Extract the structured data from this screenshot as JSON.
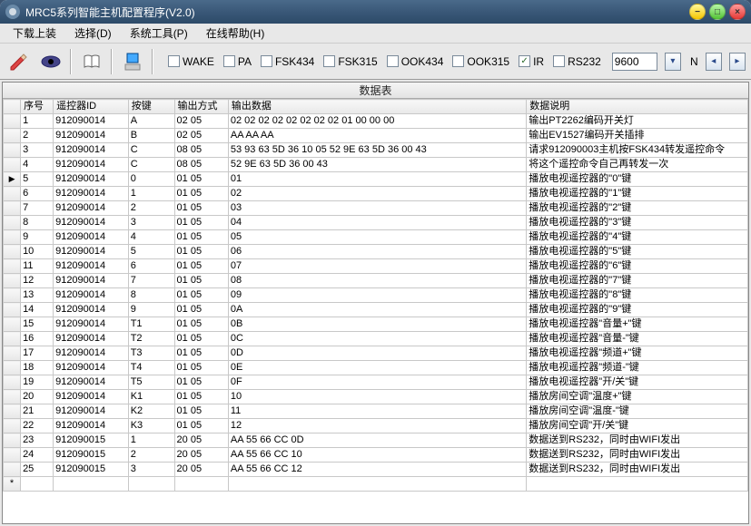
{
  "window": {
    "title": "MRC5系列智能主机配置程序(V2.0)"
  },
  "menu": {
    "download": "下载上装",
    "select": "选择(D)",
    "tools": "系统工具(P)",
    "help": "在线帮助(H)"
  },
  "checks": [
    {
      "label": "WAKE",
      "checked": false
    },
    {
      "label": "PA",
      "checked": false
    },
    {
      "label": "FSK434",
      "checked": false
    },
    {
      "label": "FSK315",
      "checked": false
    },
    {
      "label": "OOK434",
      "checked": false
    },
    {
      "label": "OOK315",
      "checked": false
    },
    {
      "label": "IR",
      "checked": true
    },
    {
      "label": "RS232",
      "checked": false
    }
  ],
  "baud": "9600",
  "navlabel": "N",
  "table": {
    "title": "数据表",
    "cols": {
      "seq": "序号",
      "id": "遥控器ID",
      "key": "按键",
      "mode": "输出方式",
      "out": "输出数据",
      "desc": "数据说明"
    },
    "rows": [
      {
        "seq": "1",
        "id": "912090014",
        "key": "A",
        "mode": "02 05",
        "out": "02 02 02 02 02 02 02 02 01 00 00 00",
        "desc": "输出PT2262编码开关灯"
      },
      {
        "seq": "2",
        "id": "912090014",
        "key": "B",
        "mode": "02 05",
        "out": "AA AA AA",
        "desc": "输出EV1527编码开关插排"
      },
      {
        "seq": "3",
        "id": "912090014",
        "key": "C",
        "mode": "08 05",
        "out": "53 93 63 5D 36 10 05 52 9E 63 5D 36 00 43",
        "desc": "请求912090003主机按FSK434转发遥控命令"
      },
      {
        "seq": "4",
        "id": "912090014",
        "key": "C",
        "mode": "08 05",
        "out": "52 9E 63 5D 36 00 43",
        "desc": "将这个遥控命令自己再转发一次"
      },
      {
        "seq": "5",
        "id": "912090014",
        "key": "0",
        "mode": "01 05",
        "out": "01",
        "desc": "播放电视遥控器的\"0\"键",
        "sel": true
      },
      {
        "seq": "6",
        "id": "912090014",
        "key": "1",
        "mode": "01 05",
        "out": "02",
        "desc": "播放电视遥控器的\"1\"键"
      },
      {
        "seq": "7",
        "id": "912090014",
        "key": "2",
        "mode": "01 05",
        "out": "03",
        "desc": "播放电视遥控器的\"2\"键"
      },
      {
        "seq": "8",
        "id": "912090014",
        "key": "3",
        "mode": "01 05",
        "out": "04",
        "desc": "播放电视遥控器的\"3\"键"
      },
      {
        "seq": "9",
        "id": "912090014",
        "key": "4",
        "mode": "01 05",
        "out": "05",
        "desc": "播放电视遥控器的\"4\"键"
      },
      {
        "seq": "10",
        "id": "912090014",
        "key": "5",
        "mode": "01 05",
        "out": "06",
        "desc": "播放电视遥控器的\"5\"键"
      },
      {
        "seq": "11",
        "id": "912090014",
        "key": "6",
        "mode": "01 05",
        "out": "07",
        "desc": "播放电视遥控器的\"6\"键"
      },
      {
        "seq": "12",
        "id": "912090014",
        "key": "7",
        "mode": "01 05",
        "out": "08",
        "desc": "播放电视遥控器的\"7\"键"
      },
      {
        "seq": "13",
        "id": "912090014",
        "key": "8",
        "mode": "01 05",
        "out": "09",
        "desc": "播放电视遥控器的\"8\"键"
      },
      {
        "seq": "14",
        "id": "912090014",
        "key": "9",
        "mode": "01 05",
        "out": "0A",
        "desc": "播放电视遥控器的\"9\"键"
      },
      {
        "seq": "15",
        "id": "912090014",
        "key": "T1",
        "mode": "01 05",
        "out": "0B",
        "desc": "播放电视遥控器\"音量+\"键"
      },
      {
        "seq": "16",
        "id": "912090014",
        "key": "T2",
        "mode": "01 05",
        "out": "0C",
        "desc": "播放电视遥控器\"音量-\"键"
      },
      {
        "seq": "17",
        "id": "912090014",
        "key": "T3",
        "mode": "01 05",
        "out": "0D",
        "desc": "播放电视遥控器\"频道+\"键"
      },
      {
        "seq": "18",
        "id": "912090014",
        "key": "T4",
        "mode": "01 05",
        "out": "0E",
        "desc": "播放电视遥控器\"频道-\"键"
      },
      {
        "seq": "19",
        "id": "912090014",
        "key": "T5",
        "mode": "01 05",
        "out": "0F",
        "desc": "播放电视遥控器\"开/关\"键"
      },
      {
        "seq": "20",
        "id": "912090014",
        "key": "K1",
        "mode": "01 05",
        "out": "10",
        "desc": "播放房间空调\"温度+\"键"
      },
      {
        "seq": "21",
        "id": "912090014",
        "key": "K2",
        "mode": "01 05",
        "out": "11",
        "desc": "播放房间空调\"温度-\"键"
      },
      {
        "seq": "22",
        "id": "912090014",
        "key": "K3",
        "mode": "01 05",
        "out": "12",
        "desc": "播放房间空调\"开/关\"键"
      },
      {
        "seq": "23",
        "id": "912090015",
        "key": "1",
        "mode": "20 05",
        "out": "AA 55 66 CC 0D",
        "desc": "数据送到RS232，同时由WIFI发出"
      },
      {
        "seq": "24",
        "id": "912090015",
        "key": "2",
        "mode": "20 05",
        "out": "AA 55 66 CC 10",
        "desc": "数据送到RS232，同时由WIFI发出"
      },
      {
        "seq": "25",
        "id": "912090015",
        "key": "3",
        "mode": "20 05",
        "out": "AA 55 66 CC 12",
        "desc": "数据送到RS232，同时由WIFI发出"
      }
    ]
  }
}
